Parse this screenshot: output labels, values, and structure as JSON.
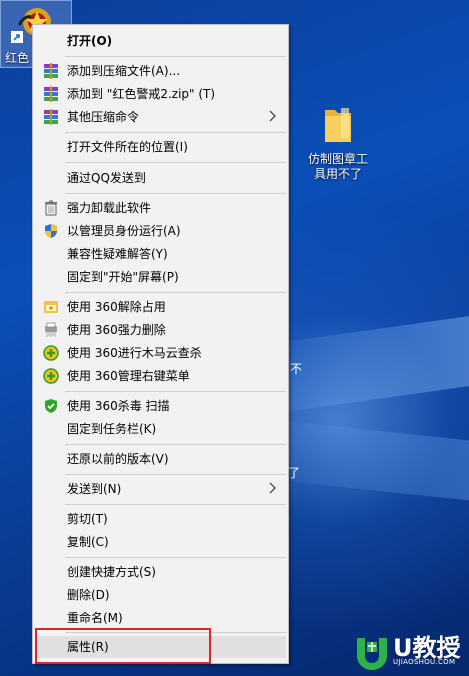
{
  "desktop": {
    "icons": [
      {
        "label": "红色"
      },
      {
        "label_line1": "仿制图章工",
        "label_line2": "具用不了"
      }
    ],
    "peek_glyphs": [
      "不",
      "了"
    ],
    "watermark": {
      "main": "U教授",
      "sub": "UJIAOSHOU.COM"
    }
  },
  "menu": {
    "items": [
      {
        "label": "打开(O)"
      },
      {
        "label": "添加到压缩文件(A)..."
      },
      {
        "label": "添加到 \"红色警戒2.zip\" (T)"
      },
      {
        "label": "其他压缩命令"
      },
      {
        "label": "打开文件所在的位置(I)"
      },
      {
        "label": "通过QQ发送到"
      },
      {
        "label": "强力卸载此软件"
      },
      {
        "label": "以管理员身份运行(A)"
      },
      {
        "label": "兼容性疑难解答(Y)"
      },
      {
        "label": "固定到\"开始\"屏幕(P)"
      },
      {
        "label": "使用 360解除占用"
      },
      {
        "label": "使用 360强力删除"
      },
      {
        "label": "使用 360进行木马云查杀"
      },
      {
        "label": "使用 360管理右键菜单"
      },
      {
        "label": "使用 360杀毒 扫描"
      },
      {
        "label": "固定到任务栏(K)"
      },
      {
        "label": "还原以前的版本(V)"
      },
      {
        "label": "发送到(N)"
      },
      {
        "label": "剪切(T)"
      },
      {
        "label": "复制(C)"
      },
      {
        "label": "创建快捷方式(S)"
      },
      {
        "label": "删除(D)"
      },
      {
        "label": "重命名(M)"
      },
      {
        "label": "属性(R)"
      }
    ]
  },
  "colors": {
    "menu_bg": "#f2f2f2",
    "highlight_border": "#e0262a",
    "desktop_blue": "#0a4fb8"
  }
}
